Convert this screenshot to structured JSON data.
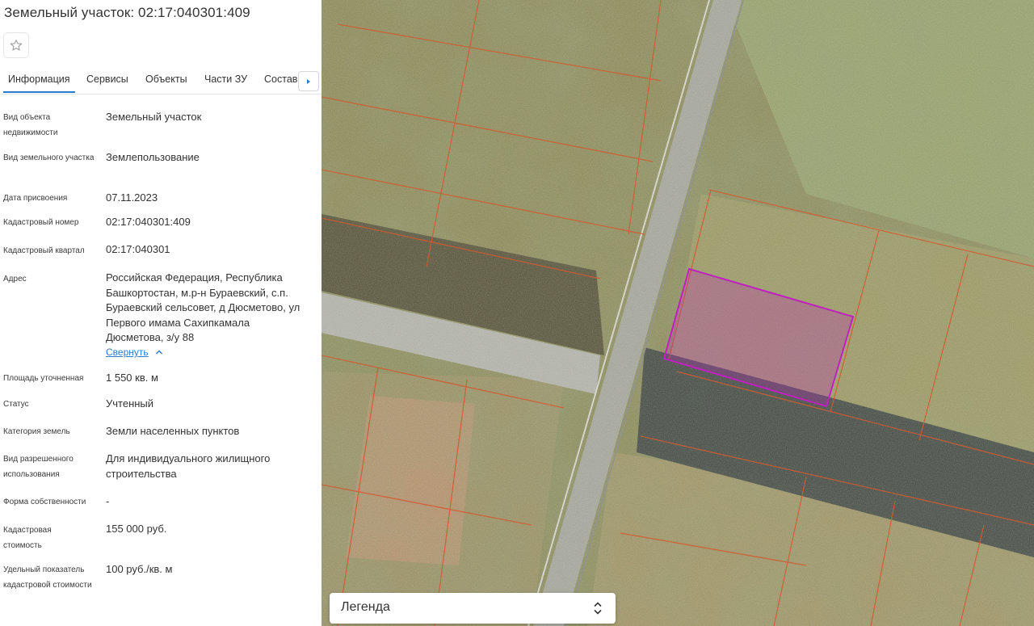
{
  "panel": {
    "title": "Земельный участок: 02:17:040301:409",
    "favorite_icon": "star-outline-icon",
    "tabs": [
      "Информация",
      "Сервисы",
      "Объекты",
      "Части ЗУ",
      "Состав"
    ],
    "tab_scroll_icon": "triangle-right-icon",
    "fields": [
      {
        "label": "Вид объекта недвижимости",
        "value": "Земельный участок"
      },
      {
        "label": "Вид земельного участка",
        "value": "Землепользование"
      },
      {
        "label": "Дата присвоения",
        "value": "07.11.2023"
      },
      {
        "label": "Кадастровый номер",
        "value": "02:17:040301:409"
      },
      {
        "label": "Кадастровый квартал",
        "value": "02:17:040301"
      },
      {
        "label": "Адрес",
        "value": "Российская Федерация, Республика Башкортостан, м.р-н Бураевский, с.п. Бураевский сельсовет, д Дюсметово, ул Первого имама Сахипкамала Дюсметова, з/у 88"
      },
      {
        "label": "Площадь уточненная",
        "value": "1 550 кв. м"
      },
      {
        "label": "Статус",
        "value": "Учтенный"
      },
      {
        "label": "Категория земель",
        "value": "Земли населенных пунктов"
      },
      {
        "label": "Вид разрешенного использования",
        "value": "Для индивидуального жилищного строительства"
      },
      {
        "label": "Форма собственности",
        "value": "-"
      },
      {
        "label": "Кадастровая стоимость",
        "value": "155 000 руб."
      },
      {
        "label": "Удельный показатель кадастровой стоимости",
        "value": "100 руб./кв. м"
      }
    ],
    "collapse_label": "Свернуть",
    "collapse_icon": "chevron-up-icon"
  },
  "map": {
    "parcel_highlight_color": "#c020c0",
    "boundary_color": "#d35a32"
  },
  "legend": {
    "label": "Легенда",
    "toggle_icon": "chevron-up-down-icon"
  }
}
